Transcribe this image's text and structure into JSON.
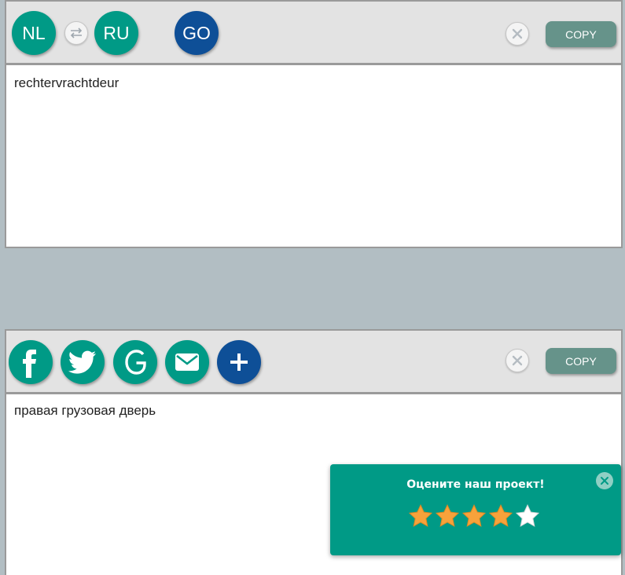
{
  "source": {
    "lang_from": "NL",
    "lang_to": "RU",
    "go_label": "GO",
    "copy_label": "COPY",
    "text": "rechtervrachtdeur"
  },
  "result": {
    "copy_label": "COPY",
    "text": "правая грузовая дверь",
    "share_icons": [
      "facebook-icon",
      "twitter-icon",
      "google-icon",
      "mail-icon",
      "plus-icon"
    ]
  },
  "rating_popup": {
    "title": "Оцените наш проект!",
    "stars_total": 5,
    "stars_filled": 4
  },
  "colors": {
    "teal": "#009a86",
    "navy": "#0e4f97",
    "copy_button": "#66938a",
    "background": "#b2bec3",
    "star_filled": "#f7a23b",
    "star_empty": "#ffffff"
  }
}
